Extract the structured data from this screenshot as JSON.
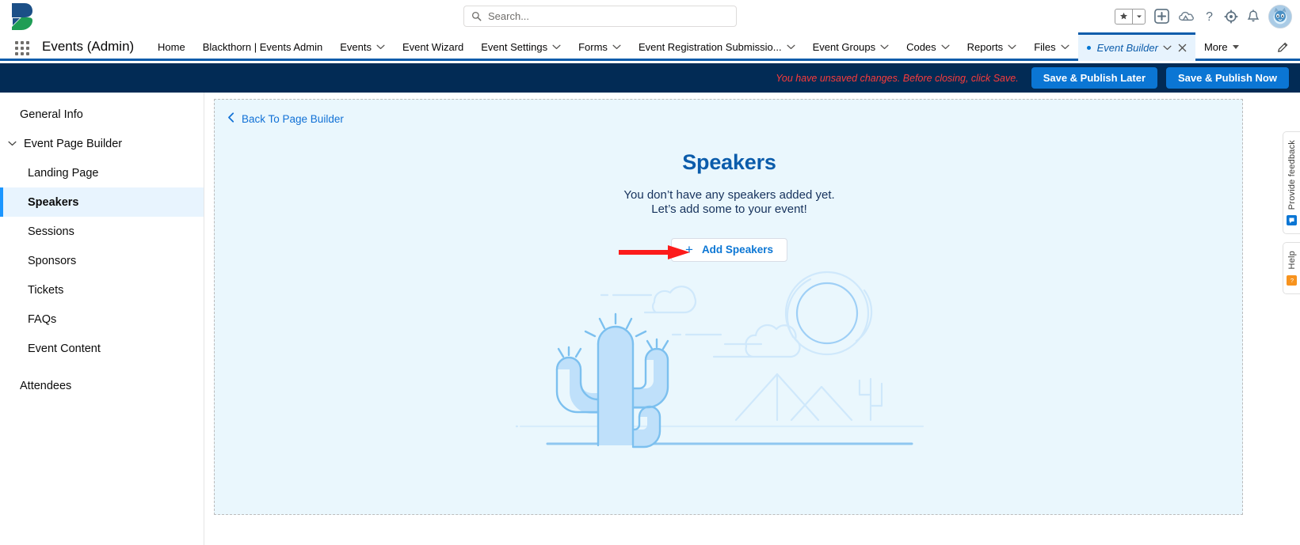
{
  "header": {
    "logo_name": "blackthorn-logo",
    "search": {
      "placeholder": "Search...",
      "value": "",
      "icon": "search-icon"
    },
    "icons": [
      {
        "name": "favorites-star-icon",
        "glyph": "★"
      },
      {
        "name": "favorites-dropdown-icon",
        "glyph": "▾"
      },
      {
        "name": "global-actions-plus-icon",
        "glyph": "+"
      },
      {
        "name": "trailhead-cloud-icon",
        "glyph": "☁"
      },
      {
        "name": "help-question-icon",
        "glyph": "?"
      },
      {
        "name": "setup-gear-icon",
        "glyph": "⚙"
      },
      {
        "name": "notifications-bell-icon",
        "glyph": "🔔"
      },
      {
        "name": "user-avatar",
        "glyph": ""
      }
    ]
  },
  "appnav": {
    "waffle_label": "app-launcher",
    "app_title": "Events (Admin)",
    "tabs": [
      {
        "label": "Home",
        "dropdown": false,
        "active": false,
        "closable": false
      },
      {
        "label": "Blackthorn | Events Admin",
        "dropdown": false,
        "active": false,
        "closable": false
      },
      {
        "label": "Events",
        "dropdown": true,
        "active": false,
        "closable": false
      },
      {
        "label": "Event Wizard",
        "dropdown": false,
        "active": false,
        "closable": false
      },
      {
        "label": "Event Settings",
        "dropdown": true,
        "active": false,
        "closable": false
      },
      {
        "label": "Forms",
        "dropdown": true,
        "active": false,
        "closable": false
      },
      {
        "label": "Event Registration Submissio...",
        "dropdown": true,
        "active": false,
        "closable": false
      },
      {
        "label": "Event Groups",
        "dropdown": true,
        "active": false,
        "closable": false
      },
      {
        "label": "Codes",
        "dropdown": true,
        "active": false,
        "closable": false
      },
      {
        "label": "Reports",
        "dropdown": true,
        "active": false,
        "closable": false
      },
      {
        "label": "Files",
        "dropdown": true,
        "active": false,
        "closable": false
      },
      {
        "label": "Event Builder",
        "dropdown": true,
        "active": true,
        "closable": true,
        "unsaved": true
      },
      {
        "label": "More",
        "dropdown": true,
        "active": false,
        "closable": false,
        "caret": true
      }
    ],
    "edit_pencil": "edit-tabs-pencil-icon"
  },
  "action_bar": {
    "unsaved_message": "You have unsaved changes. Before closing, click Save.",
    "save_later_label": "Save & Publish Later",
    "save_now_label": "Save & Publish Now",
    "bar_color": "#022b55",
    "button_color": "#0b76d4",
    "message_color": "#fb3a3a"
  },
  "sidebar": {
    "items": [
      {
        "label": "General Info",
        "type": "top",
        "selected": false
      },
      {
        "label": "Event Page Builder",
        "type": "group",
        "selected": false,
        "expanded": true
      },
      {
        "label": "Landing Page",
        "type": "child",
        "selected": false
      },
      {
        "label": "Speakers",
        "type": "child",
        "selected": true
      },
      {
        "label": "Sessions",
        "type": "child",
        "selected": false
      },
      {
        "label": "Sponsors",
        "type": "child",
        "selected": false
      },
      {
        "label": "Tickets",
        "type": "child",
        "selected": false
      },
      {
        "label": "FAQs",
        "type": "child",
        "selected": false
      },
      {
        "label": "Event Content",
        "type": "child",
        "selected": false
      },
      {
        "label": "Attendees",
        "type": "top",
        "selected": false,
        "spaced": true
      }
    ],
    "selected_bg": "#e8f4fe",
    "selected_accent": "#1b96ff"
  },
  "main": {
    "back_link": "Back To Page Builder",
    "back_icon": "chevron-left-icon",
    "empty_state": {
      "title": "Speakers",
      "message_line1": "You don’t have any speakers added yet.",
      "message_line2": "Let’s add some to your event!",
      "button_label": "Add Speakers",
      "button_icon": "plus-icon",
      "title_color": "#0b5cab",
      "panel_bg": "#eaf7fd",
      "illustration": "desert-cactus-empty-state-illustration"
    },
    "annotation": {
      "name": "red-arrow-annotation",
      "color": "#fc1b1b",
      "points_to": "Add Speakers"
    }
  },
  "rail": {
    "feedback_label": "Provide feedback",
    "feedback_badge_color": "#0b76d4",
    "help_label": "Help",
    "help_badge_color": "#f7931e"
  }
}
